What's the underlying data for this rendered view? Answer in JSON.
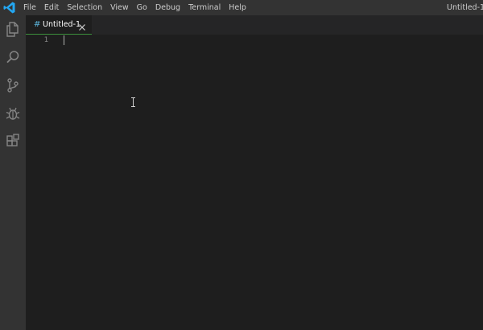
{
  "menubar": {
    "items": [
      "File",
      "Edit",
      "Selection",
      "View",
      "Go",
      "Debug",
      "Terminal",
      "Help"
    ]
  },
  "window": {
    "title": "Untitled-1 - "
  },
  "activitybar": {
    "icons": [
      "explorer-icon",
      "search-icon",
      "source-control-icon",
      "debug-icon",
      "extensions-icon"
    ]
  },
  "tabs": [
    {
      "label": "Untitled-1",
      "lang_icon": "#",
      "active": true
    }
  ],
  "editor": {
    "line_numbers": [
      "1"
    ],
    "lines": [
      ""
    ]
  },
  "colors": {
    "titlebar": "#333333",
    "activitybar": "#333333",
    "tabbar": "#252526",
    "editor": "#1e1e1e",
    "tab_accent": "#3c8f3c",
    "text": "#cccccc",
    "logo": "#23a7f2"
  }
}
